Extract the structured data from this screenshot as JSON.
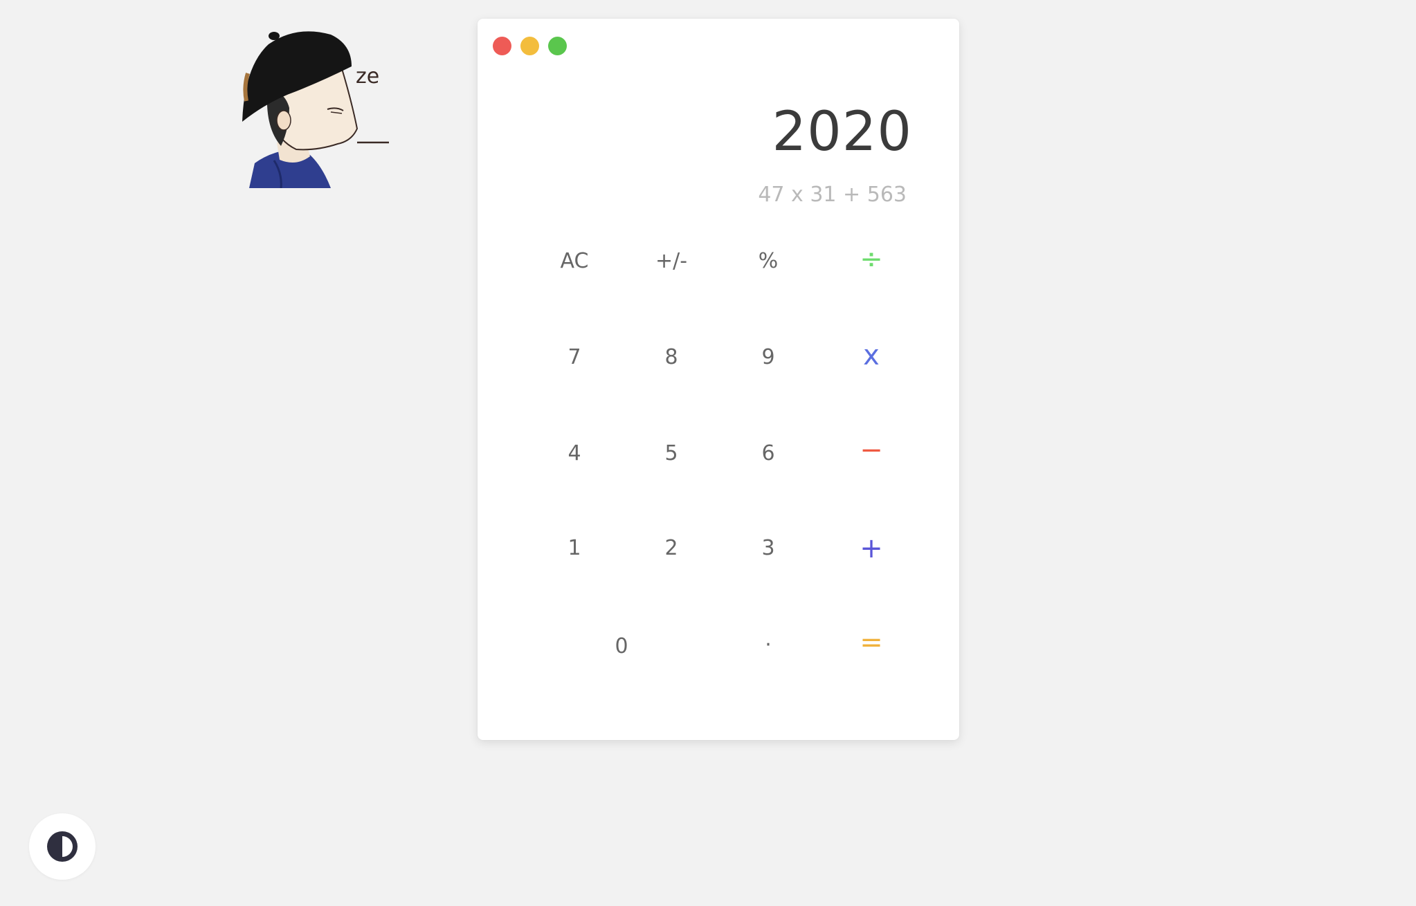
{
  "avatar": {
    "caption": "ze"
  },
  "window": {
    "buttons": {
      "close_color": "#ee5b56",
      "minimize_color": "#f3bd3d",
      "maximize_color": "#5ac64d"
    }
  },
  "display": {
    "result": "2020",
    "expression": "47 x 31 + 563"
  },
  "keys": {
    "ac": "AC",
    "sign": "+/-",
    "percent": "%",
    "divide": "÷",
    "seven": "7",
    "eight": "8",
    "nine": "9",
    "multiply": "x",
    "four": "4",
    "five": "5",
    "six": "6",
    "minus": "−",
    "one": "1",
    "two": "2",
    "three": "3",
    "plus": "+",
    "zero": "0",
    "decimal": "·",
    "equals": "="
  },
  "colors": {
    "divide": "#6fdc6f",
    "multiply": "#5b6fe0",
    "minus": "#ef5a42",
    "plus": "#5a56d8",
    "equals": "#f0b23d",
    "digit": "#666666",
    "result": "#3b3b3b",
    "expression": "#b9b9b9"
  },
  "theme_toggle": {
    "icon": "contrast-icon"
  }
}
